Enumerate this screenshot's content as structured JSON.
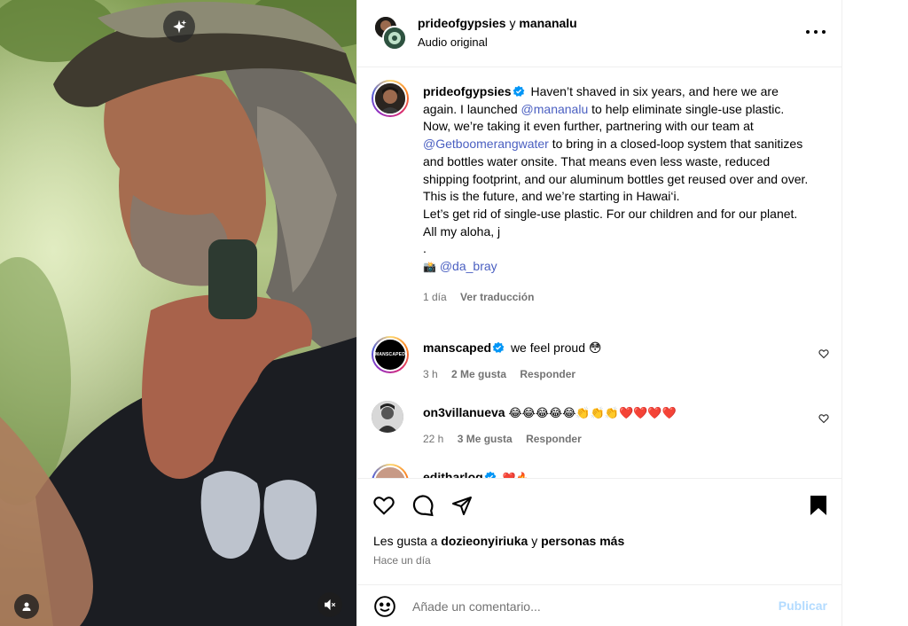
{
  "colors": {
    "accent": "#0095f6",
    "link": "#4a5fc1",
    "muted": "#737373",
    "post_disabled": "#b3dbff",
    "heart": "#e8112d"
  },
  "media": {
    "icons": [
      "sparkle-icon",
      "user-tag-icon",
      "mute-icon"
    ]
  },
  "header": {
    "author1": "prideofgypsies",
    "conjunction": "y",
    "author2": "mananalu",
    "subtitle": "Audio original"
  },
  "caption": {
    "username": "prideofgypsies",
    "text_1": " Haven’t shaved in six years, and here we are again. I launched ",
    "mention_1": "@mananalu",
    "text_2": " to help eliminate single-use plastic. Now, we’re taking it even further, partnering with our team at ",
    "mention_2": "@Getboomerangwater",
    "text_3": " to bring in a closed-loop system that sanitizes and bottles water onsite. That means even less waste, reduced shipping footprint, and our aluminum bottles get reused over and over. This is the future, and we’re starting in Hawai‘i.",
    "text_4": "Let’s get rid of single-use plastic. For our children and for our planet. All my aloha, j",
    "dot": ".",
    "camera_emoji": "📸",
    "mention_3": "@da_bray",
    "time": "1 día",
    "translate": "Ver traducción"
  },
  "comments": [
    {
      "username": "manscaped",
      "text": "we feel proud 😳",
      "time": "3 h",
      "likes": "2 Me gusta",
      "reply": "Responder",
      "avatar_text": "MANSCAPED"
    },
    {
      "username": "on3villanueva",
      "text": "😂😂😂😂😂👏👏👏❤️❤️❤️❤️",
      "time": "22 h",
      "likes": "3 Me gusta",
      "reply": "Responder"
    },
    {
      "username": "editharlog",
      "text": "❤️🔥"
    }
  ],
  "likes": {
    "prefix": "Les gusta a ",
    "user": "dozieonyiriuka",
    "middle": " y ",
    "others": "personas más",
    "ago": "Hace un día"
  },
  "composer": {
    "placeholder": "Añade un comentario...",
    "post_label": "Publicar"
  }
}
